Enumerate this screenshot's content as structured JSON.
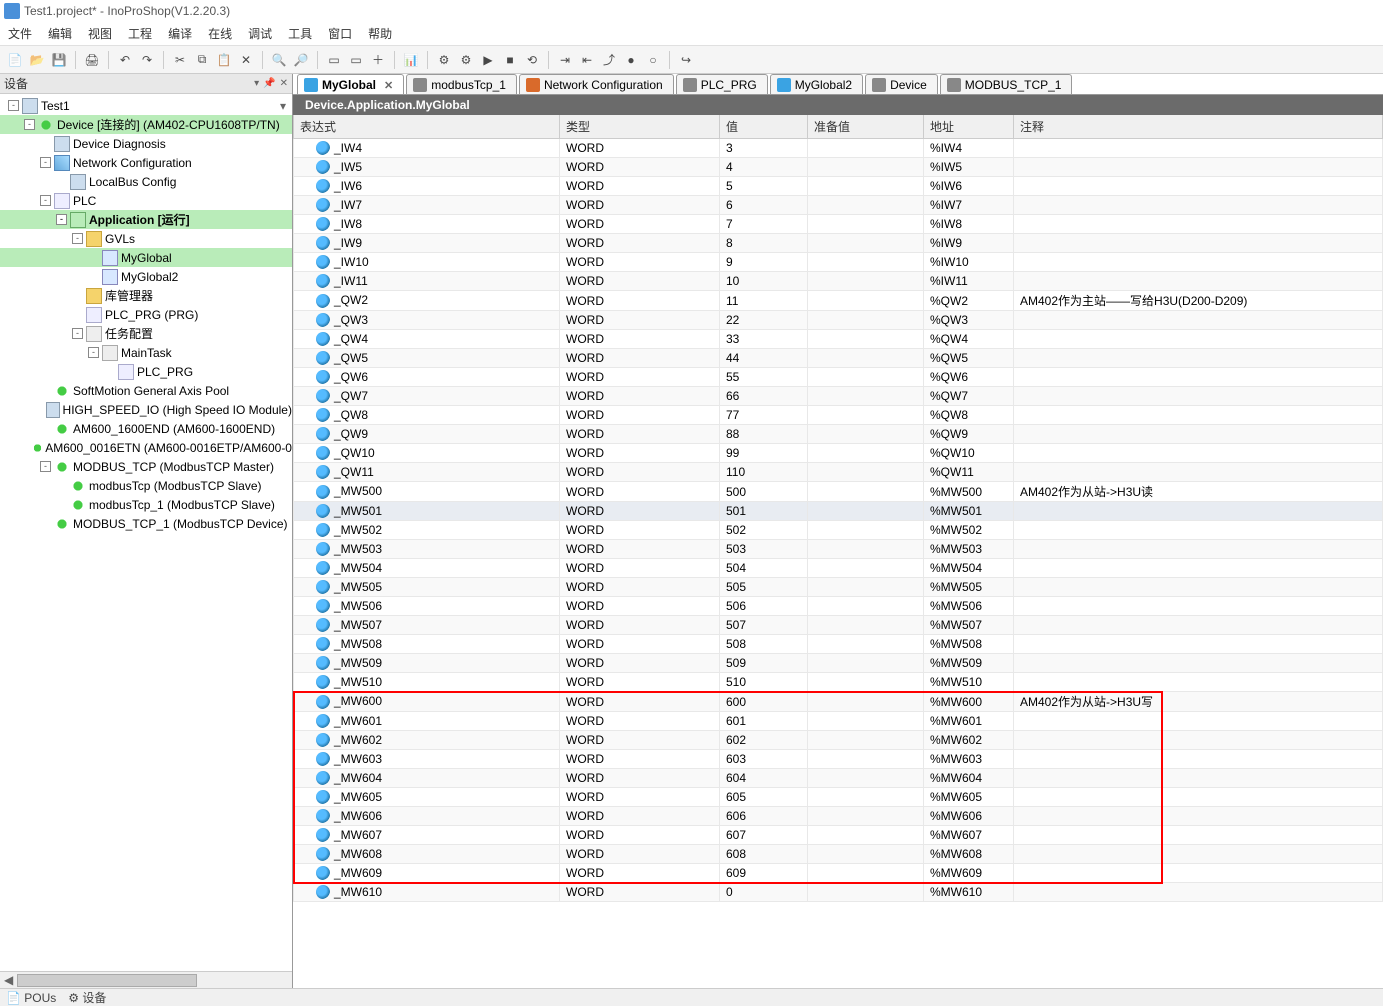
{
  "window": {
    "title": "Test1.project* - InoProShop(V1.2.20.3)"
  },
  "menu": [
    "文件",
    "编辑",
    "视图",
    "工程",
    "编译",
    "在线",
    "调试",
    "工具",
    "窗口",
    "帮助"
  ],
  "left_pane": {
    "title": "设备",
    "tree": [
      {
        "indent": 0,
        "toggle": "-",
        "icon": "icon-device",
        "label": "Test1",
        "dd": true
      },
      {
        "indent": 1,
        "toggle": "-",
        "icon": "icon-green-arrows",
        "label": "Device [连接的] (AM402-CPU1608TP/TN)",
        "sel": "sel-green"
      },
      {
        "indent": 2,
        "toggle": "",
        "icon": "icon-device",
        "label": "Device Diagnosis"
      },
      {
        "indent": 2,
        "toggle": "-",
        "icon": "icon-net",
        "label": "Network Configuration"
      },
      {
        "indent": 3,
        "toggle": "",
        "icon": "icon-device",
        "label": "LocalBus Config"
      },
      {
        "indent": 2,
        "toggle": "-",
        "icon": "icon-prg",
        "label": "PLC"
      },
      {
        "indent": 3,
        "toggle": "-",
        "icon": "icon-app",
        "label": "Application [运行]",
        "sel": "sel-green2"
      },
      {
        "indent": 4,
        "toggle": "-",
        "icon": "icon-folder",
        "label": "GVLs"
      },
      {
        "indent": 5,
        "toggle": "",
        "icon": "icon-gvl",
        "label": "MyGlobal",
        "sel": "sel-green"
      },
      {
        "indent": 5,
        "toggle": "",
        "icon": "icon-gvl",
        "label": "MyGlobal2"
      },
      {
        "indent": 4,
        "toggle": "",
        "icon": "icon-folder",
        "label": "库管理器"
      },
      {
        "indent": 4,
        "toggle": "",
        "icon": "icon-prg",
        "label": "PLC_PRG (PRG)"
      },
      {
        "indent": 4,
        "toggle": "-",
        "icon": "icon-task",
        "label": "任务配置"
      },
      {
        "indent": 5,
        "toggle": "-",
        "icon": "icon-task",
        "label": "MainTask"
      },
      {
        "indent": 6,
        "toggle": "",
        "icon": "icon-prg",
        "label": "PLC_PRG"
      },
      {
        "indent": 2,
        "toggle": "",
        "icon": "icon-green-arrows",
        "label": "SoftMotion General Axis Pool"
      },
      {
        "indent": 2,
        "toggle": "",
        "icon": "icon-device",
        "label": "HIGH_SPEED_IO (High Speed IO Module)"
      },
      {
        "indent": 2,
        "toggle": "",
        "icon": "icon-green-arrows",
        "label": "AM600_1600END (AM600-1600END)"
      },
      {
        "indent": 2,
        "toggle": "",
        "icon": "icon-green-arrows",
        "label": "AM600_0016ETN (AM600-0016ETP/AM600-0"
      },
      {
        "indent": 2,
        "toggle": "-",
        "icon": "icon-green-arrows",
        "label": "MODBUS_TCP (ModbusTCP Master)"
      },
      {
        "indent": 3,
        "toggle": "",
        "icon": "icon-green-arrows",
        "label": "modbusTcp (ModbusTCP Slave)"
      },
      {
        "indent": 3,
        "toggle": "",
        "icon": "icon-green-arrows",
        "label": "modbusTcp_1 (ModbusTCP Slave)"
      },
      {
        "indent": 2,
        "toggle": "",
        "icon": "icon-green-arrows",
        "label": "MODBUS_TCP_1 (ModbusTCP Device)"
      }
    ]
  },
  "tabs": [
    {
      "label": "MyGlobal",
      "icon": "#3aa3e3",
      "active": true,
      "closable": true
    },
    {
      "label": "modbusTcp_1",
      "icon": "#888"
    },
    {
      "label": "Network Configuration",
      "icon": "#d96a2b"
    },
    {
      "label": "PLC_PRG",
      "icon": "#888"
    },
    {
      "label": "MyGlobal2",
      "icon": "#3aa3e3"
    },
    {
      "label": "Device",
      "icon": "#888"
    },
    {
      "label": "MODBUS_TCP_1",
      "icon": "#888"
    }
  ],
  "breadcrumb": "Device.Application.MyGlobal",
  "columns": [
    "表达式",
    "类型",
    "值",
    "准备值",
    "地址",
    "注释"
  ],
  "rows": [
    {
      "name": "_IW4",
      "type": "WORD",
      "val": "3",
      "addr": "%IW4"
    },
    {
      "name": "_IW5",
      "type": "WORD",
      "val": "4",
      "addr": "%IW5"
    },
    {
      "name": "_IW6",
      "type": "WORD",
      "val": "5",
      "addr": "%IW6"
    },
    {
      "name": "_IW7",
      "type": "WORD",
      "val": "6",
      "addr": "%IW7"
    },
    {
      "name": "_IW8",
      "type": "WORD",
      "val": "7",
      "addr": "%IW8"
    },
    {
      "name": "_IW9",
      "type": "WORD",
      "val": "8",
      "addr": "%IW9"
    },
    {
      "name": "_IW10",
      "type": "WORD",
      "val": "9",
      "addr": "%IW10"
    },
    {
      "name": "_IW11",
      "type": "WORD",
      "val": "10",
      "addr": "%IW11"
    },
    {
      "name": "_QW2",
      "type": "WORD",
      "val": "11",
      "addr": "%QW2",
      "comment": "AM402作为主站——写给H3U(D200-D209)"
    },
    {
      "name": "_QW3",
      "type": "WORD",
      "val": "22",
      "addr": "%QW3"
    },
    {
      "name": "_QW4",
      "type": "WORD",
      "val": "33",
      "addr": "%QW4"
    },
    {
      "name": "_QW5",
      "type": "WORD",
      "val": "44",
      "addr": "%QW5"
    },
    {
      "name": "_QW6",
      "type": "WORD",
      "val": "55",
      "addr": "%QW6"
    },
    {
      "name": "_QW7",
      "type": "WORD",
      "val": "66",
      "addr": "%QW7"
    },
    {
      "name": "_QW8",
      "type": "WORD",
      "val": "77",
      "addr": "%QW8"
    },
    {
      "name": "_QW9",
      "type": "WORD",
      "val": "88",
      "addr": "%QW9"
    },
    {
      "name": "_QW10",
      "type": "WORD",
      "val": "99",
      "addr": "%QW10"
    },
    {
      "name": "_QW11",
      "type": "WORD",
      "val": "110",
      "addr": "%QW11"
    },
    {
      "name": "_MW500",
      "type": "WORD",
      "val": "500",
      "addr": "%MW500",
      "comment": "AM402作为从站->H3U读"
    },
    {
      "name": "_MW501",
      "type": "WORD",
      "val": "501",
      "addr": "%MW501",
      "hl": true
    },
    {
      "name": "_MW502",
      "type": "WORD",
      "val": "502",
      "addr": "%MW502"
    },
    {
      "name": "_MW503",
      "type": "WORD",
      "val": "503",
      "addr": "%MW503"
    },
    {
      "name": "_MW504",
      "type": "WORD",
      "val": "504",
      "addr": "%MW504"
    },
    {
      "name": "_MW505",
      "type": "WORD",
      "val": "505",
      "addr": "%MW505"
    },
    {
      "name": "_MW506",
      "type": "WORD",
      "val": "506",
      "addr": "%MW506"
    },
    {
      "name": "_MW507",
      "type": "WORD",
      "val": "507",
      "addr": "%MW507"
    },
    {
      "name": "_MW508",
      "type": "WORD",
      "val": "508",
      "addr": "%MW508"
    },
    {
      "name": "_MW509",
      "type": "WORD",
      "val": "509",
      "addr": "%MW509"
    },
    {
      "name": "_MW510",
      "type": "WORD",
      "val": "510",
      "addr": "%MW510"
    },
    {
      "name": "_MW600",
      "type": "WORD",
      "val": "600",
      "addr": "%MW600",
      "comment": "AM402作为从站->H3U写"
    },
    {
      "name": "_MW601",
      "type": "WORD",
      "val": "601",
      "addr": "%MW601"
    },
    {
      "name": "_MW602",
      "type": "WORD",
      "val": "602",
      "addr": "%MW602"
    },
    {
      "name": "_MW603",
      "type": "WORD",
      "val": "603",
      "addr": "%MW603"
    },
    {
      "name": "_MW604",
      "type": "WORD",
      "val": "604",
      "addr": "%MW604"
    },
    {
      "name": "_MW605",
      "type": "WORD",
      "val": "605",
      "addr": "%MW605"
    },
    {
      "name": "_MW606",
      "type": "WORD",
      "val": "606",
      "addr": "%MW606"
    },
    {
      "name": "_MW607",
      "type": "WORD",
      "val": "607",
      "addr": "%MW607"
    },
    {
      "name": "_MW608",
      "type": "WORD",
      "val": "608",
      "addr": "%MW608"
    },
    {
      "name": "_MW609",
      "type": "WORD",
      "val": "609",
      "addr": "%MW609"
    },
    {
      "name": "_MW610",
      "type": "WORD",
      "val": "0",
      "addr": "%MW610"
    }
  ],
  "status": {
    "pous": "POUs",
    "devices": "设备"
  },
  "redbox": {
    "start_row_name": "_MW600",
    "end_row_name": "_MW609"
  }
}
